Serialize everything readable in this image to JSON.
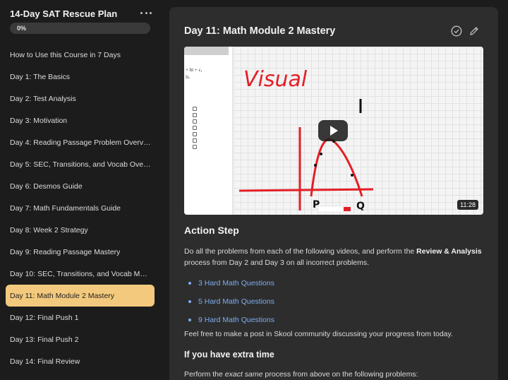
{
  "sidebar": {
    "course_title": "14-Day SAT Rescue Plan",
    "progress_label": "0%",
    "progress_value": 0,
    "items": [
      {
        "label": "How to Use this Course in 7 Days",
        "active": false
      },
      {
        "label": "Day 1: The Basics",
        "active": false
      },
      {
        "label": "Day 2: Test Analysis",
        "active": false
      },
      {
        "label": "Day 3: Motivation",
        "active": false
      },
      {
        "label": "Day 4: Reading Passage Problem Overview",
        "active": false
      },
      {
        "label": "Day 5: SEC, Transitions, and Vocab Overvi...",
        "active": false
      },
      {
        "label": "Day 6: Desmos Guide",
        "active": false
      },
      {
        "label": "Day 7: Math Fundamentals Guide",
        "active": false
      },
      {
        "label": "Day 8: Week 2 Strategy",
        "active": false
      },
      {
        "label": "Day 9: Reading Passage Mastery",
        "active": false
      },
      {
        "label": "Day 10: SEC, Transitions, and Vocab Mast...",
        "active": false
      },
      {
        "label": "Day 11: Math Module 2 Mastery",
        "active": true
      },
      {
        "label": "Day 12: Final Push 1",
        "active": false
      },
      {
        "label": "Day 13: Final Push 2",
        "active": false
      },
      {
        "label": "Day 14: Final Review",
        "active": false
      }
    ]
  },
  "main": {
    "title": "Day 11: Math Module 2 Mastery",
    "video": {
      "handwriting": "Visual",
      "duration": "11:28",
      "doc_lines": [
        "+ bt + c,",
        "ls."
      ],
      "point_labels": [
        "P",
        "Q"
      ]
    },
    "action_heading": "Action Step",
    "action_text_1": "Do all the problems from each of the following videos, and perform the ",
    "action_bold": "Review & Analysis",
    "action_text_2": " process from Day 2 and Day 3 on all incorrect problems.",
    "links": [
      "3 Hard Math Questions",
      "5 Hard Math Questions",
      "9 Hard Math Questions"
    ],
    "community_text": "Feel free to make a post in Skool community discussing your progress from today.",
    "extra_heading": "If you have extra time",
    "extra_text_1": "Perform the ",
    "extra_italic": "exact same",
    "extra_text_2": " process from above on the following problems:"
  },
  "colors": {
    "active_item": "#f3c97d",
    "link": "#7eaef0",
    "ink_red": "#e41e26"
  },
  "icons": [
    "more-icon",
    "check-circle-icon",
    "pencil-icon",
    "play-icon"
  ]
}
